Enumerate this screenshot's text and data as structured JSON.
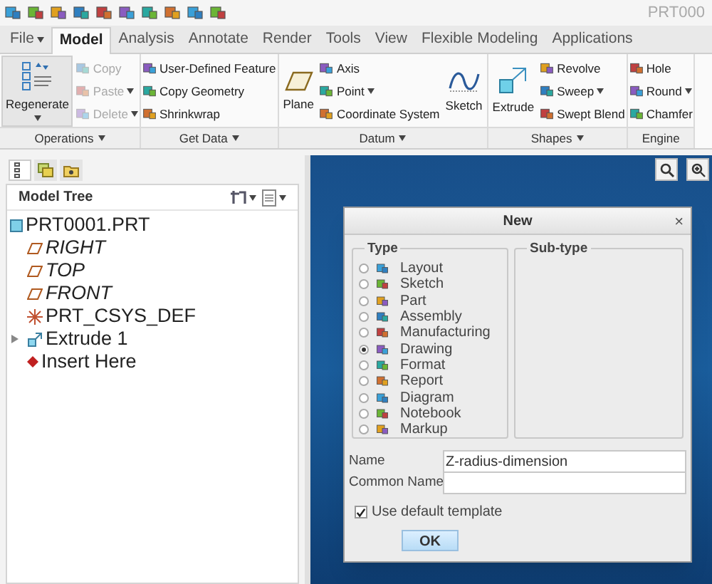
{
  "title": "PRT000",
  "tabs": [
    {
      "label": "File",
      "dropdown": true,
      "selected": false
    },
    {
      "label": "Model",
      "dropdown": false,
      "selected": true
    },
    {
      "label": "Analysis",
      "dropdown": false,
      "selected": false
    },
    {
      "label": "Annotate",
      "dropdown": false,
      "selected": false
    },
    {
      "label": "Render",
      "dropdown": false,
      "selected": false
    },
    {
      "label": "Tools",
      "dropdown": false,
      "selected": false
    },
    {
      "label": "View",
      "dropdown": false,
      "selected": false
    },
    {
      "label": "Flexible Modeling",
      "dropdown": false,
      "selected": false
    },
    {
      "label": "Applications",
      "dropdown": false,
      "selected": false
    }
  ],
  "ribbon_groups": [
    {
      "label": "Operations",
      "columns": [
        [
          {
            "kind": "large",
            "label": "Regenerate",
            "dropdown": true,
            "disabled": false
          }
        ],
        [
          {
            "kind": "small",
            "label": "Copy",
            "dropdown": false,
            "disabled": true
          },
          {
            "kind": "small",
            "label": "Paste",
            "dropdown": true,
            "disabled": true
          },
          {
            "kind": "small",
            "label": "Delete",
            "dropdown": true,
            "disabled": true
          }
        ]
      ]
    },
    {
      "label": "Get Data",
      "columns": [
        [
          {
            "kind": "small",
            "label": "User-Defined Feature",
            "dropdown": false,
            "disabled": false
          },
          {
            "kind": "small",
            "label": "Copy Geometry",
            "dropdown": false,
            "disabled": false
          },
          {
            "kind": "small",
            "label": "Shrinkwrap",
            "dropdown": false,
            "disabled": false
          }
        ]
      ]
    },
    {
      "label": "Datum",
      "columns": [
        [
          {
            "kind": "large",
            "label": "Plane",
            "dropdown": false,
            "disabled": false
          }
        ],
        [
          {
            "kind": "small",
            "label": "Axis",
            "dropdown": false,
            "disabled": false
          },
          {
            "kind": "small",
            "label": "Point",
            "dropdown": true,
            "disabled": false
          },
          {
            "kind": "small",
            "label": "Coordinate System",
            "dropdown": false,
            "disabled": false
          }
        ],
        [
          {
            "kind": "large",
            "label": "Sketch",
            "dropdown": false,
            "disabled": false
          }
        ]
      ]
    },
    {
      "label": "Shapes",
      "columns": [
        [
          {
            "kind": "large",
            "label": "Extrude",
            "dropdown": false,
            "disabled": false
          }
        ],
        [
          {
            "kind": "small",
            "label": "Revolve",
            "dropdown": false,
            "disabled": false
          },
          {
            "kind": "small",
            "label": "Sweep",
            "dropdown": true,
            "disabled": false
          },
          {
            "kind": "small",
            "label": "Swept Blend",
            "dropdown": false,
            "disabled": false
          }
        ]
      ]
    },
    {
      "label": "Engine",
      "columns": [
        [
          {
            "kind": "small",
            "label": "Hole",
            "dropdown": false,
            "disabled": false
          },
          {
            "kind": "small",
            "label": "Round",
            "dropdown": true,
            "disabled": false
          },
          {
            "kind": "small",
            "label": "Chamfer",
            "dropdown": false,
            "disabled": false
          }
        ]
      ]
    }
  ],
  "model_tree": {
    "title": "Model Tree",
    "root": {
      "label": "PRT0001.PRT",
      "children": [
        {
          "label": "RIGHT"
        },
        {
          "label": "TOP"
        },
        {
          "label": "FRONT"
        },
        {
          "label": "PRT_CSYS_DEF"
        },
        {
          "label": "Extrude 1",
          "expanded": false
        },
        {
          "label": "Insert Here"
        }
      ]
    }
  },
  "dialog": {
    "title": "New",
    "close": "×",
    "type_label": "Type",
    "subtype_label": "Sub-type",
    "types": [
      {
        "label": "Layout",
        "selected": false
      },
      {
        "label": "Sketch",
        "selected": false
      },
      {
        "label": "Part",
        "selected": false
      },
      {
        "label": "Assembly",
        "selected": false
      },
      {
        "label": "Manufacturing",
        "selected": false
      },
      {
        "label": "Drawing",
        "selected": true
      },
      {
        "label": "Format",
        "selected": false
      },
      {
        "label": "Report",
        "selected": false
      },
      {
        "label": "Diagram",
        "selected": false
      },
      {
        "label": "Notebook",
        "selected": false
      },
      {
        "label": "Markup",
        "selected": false
      }
    ],
    "name_label": "Name",
    "name_value": "Z-radius-dimension",
    "common_name_label": "Common Name",
    "use_default_template": {
      "label": "Use default template",
      "checked": true
    },
    "ok": "OK"
  }
}
